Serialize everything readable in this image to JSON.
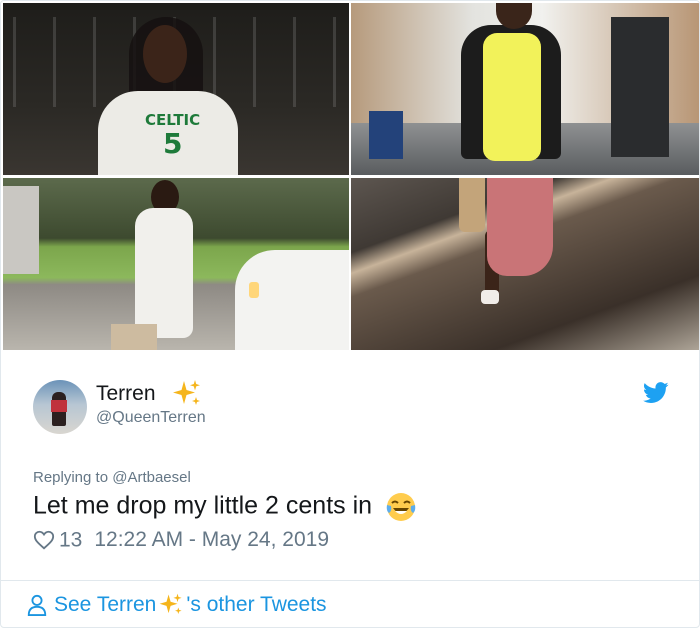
{
  "tweet": {
    "author": {
      "name": "Terren",
      "name_emoji": "sparkles-emoji",
      "handle": "@QueenTerren"
    },
    "reply_prefix": "Replying to ",
    "reply_to": "@Artbaesel",
    "text": "Let me drop my little 2 cents in",
    "text_emoji": "tears-of-joy-emoji",
    "likes": "13",
    "timestamp": "12:22 AM - May 24, 2019",
    "footer": {
      "before": "See Terren",
      "after": "'s other Tweets"
    }
  },
  "photo_1": {
    "jersey_text": "CELTIC",
    "jersey_number": "5"
  },
  "colors": {
    "link": "#1b95e0",
    "muted": "#657786",
    "text": "#14171a"
  }
}
